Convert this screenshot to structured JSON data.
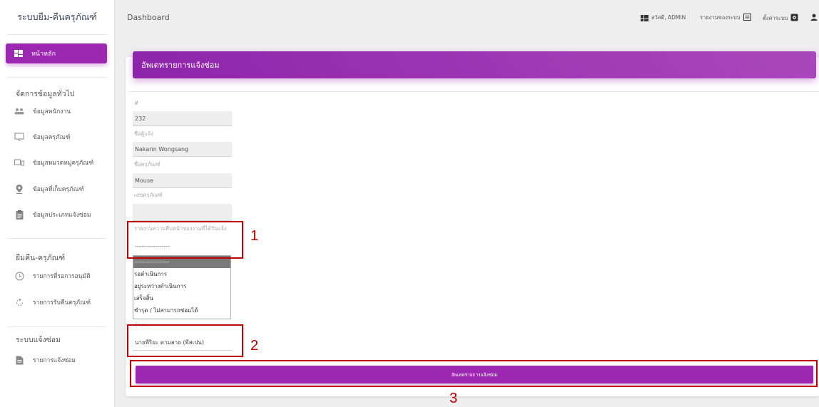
{
  "sidebar": {
    "brand": "ระบบยืม-คืนครุภัณฑ์",
    "active": "หน้าหลัก",
    "section1": "จัดการข้อมูลทั่วไป",
    "items1": [
      "ข้อมูลพนักงาน",
      "ข้อมูลครุภัณฑ์",
      "ข้อมูลหมวดหมู่ครุภัณฑ์",
      "ข้อมูลที่เก็บครุภัณฑ์",
      "ข้อมูลประเภทแจ้งซ่อม"
    ],
    "section2": "ยืมคืน-ครุภัณฑ์",
    "items2": [
      "รายการที่รอการอนุมัติ",
      "รายการรับคืนครุภัณฑ์"
    ],
    "section3": "ระบบแจ้งซ่อม",
    "items3": [
      "รายการแจ้งซ่อม"
    ]
  },
  "topbar": {
    "title": "Dashboard",
    "greeting": "สวัสดี, ADMIN",
    "report": "รายงานของระบบ",
    "settings": "ตั้งค่าระบบ"
  },
  "form": {
    "header": "อัพเดทรายการแจ้งซ่อม",
    "id_label": "#",
    "id_value": "232",
    "reporter_label": "ชื่อผู้แจ้ง",
    "reporter_value": "Nakarin Wongsang",
    "equipment_label": "ชื่อครุภัณฑ์",
    "equipment_value": "Mouse",
    "equipment_no_label": "เลขครุภัณฑ์",
    "equipment_no_value": "",
    "status_label": "รายงานความคืบหน้าของงานที่ได้รับแจ้ง",
    "status_selected": "-----------------",
    "status_options": [
      "-----------------",
      "รอดำเนินการ",
      "อยู่ระหว่างดำเนินการ",
      "เสร็จสิ้น",
      "ชำรุด / ไม่สามารถซ่อมได้"
    ],
    "technician_label": "ผู้ซ่อม",
    "technician_value": "นายพีริยะ ตามสาย (พีสเปน)",
    "submit": "อัพเดทรายการแจ้งซ่อม"
  },
  "annotations": [
    "1",
    "2",
    "3"
  ],
  "colors": {
    "accent": "#9c27b0",
    "annotation": "#c00000"
  }
}
